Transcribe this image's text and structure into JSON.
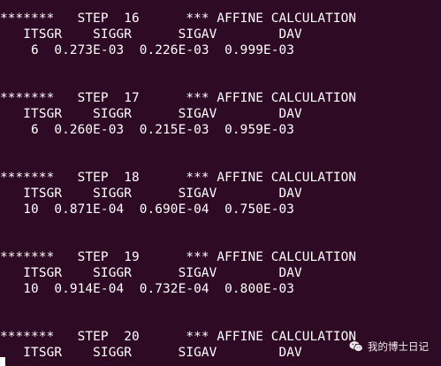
{
  "terminal": {
    "lines": [
      "*******   STEP  16      *** AFFINE CALCULATION",
      "   ITSGR    SIGGR      SIGAV        DAV",
      "    6  0.273E-03  0.226E-03  0.999E-03",
      "*******   STEP  17      *** AFFINE CALCULATION",
      "   ITSGR    SIGGR      SIGAV        DAV",
      "    6  0.260E-03  0.215E-03  0.959E-03",
      "*******   STEP  18      *** AFFINE CALCULATION",
      "   ITSGR    SIGGR      SIGAV        DAV",
      "   10  0.871E-04  0.690E-04  0.750E-03",
      "*******   STEP  19      *** AFFINE CALCULATION",
      "   ITSGR    SIGGR      SIGAV        DAV",
      "   10  0.914E-04  0.732E-04  0.800E-03",
      "*******   STEP  20      *** AFFINE CALCULATION",
      "   ITSGR    SIGGR      SIGAV        DAV"
    ]
  },
  "watermark": {
    "text": "我的博士日记",
    "icon": "wechat-icon"
  },
  "colors": {
    "background": "#2f0a24",
    "text": "#ffffff"
  }
}
